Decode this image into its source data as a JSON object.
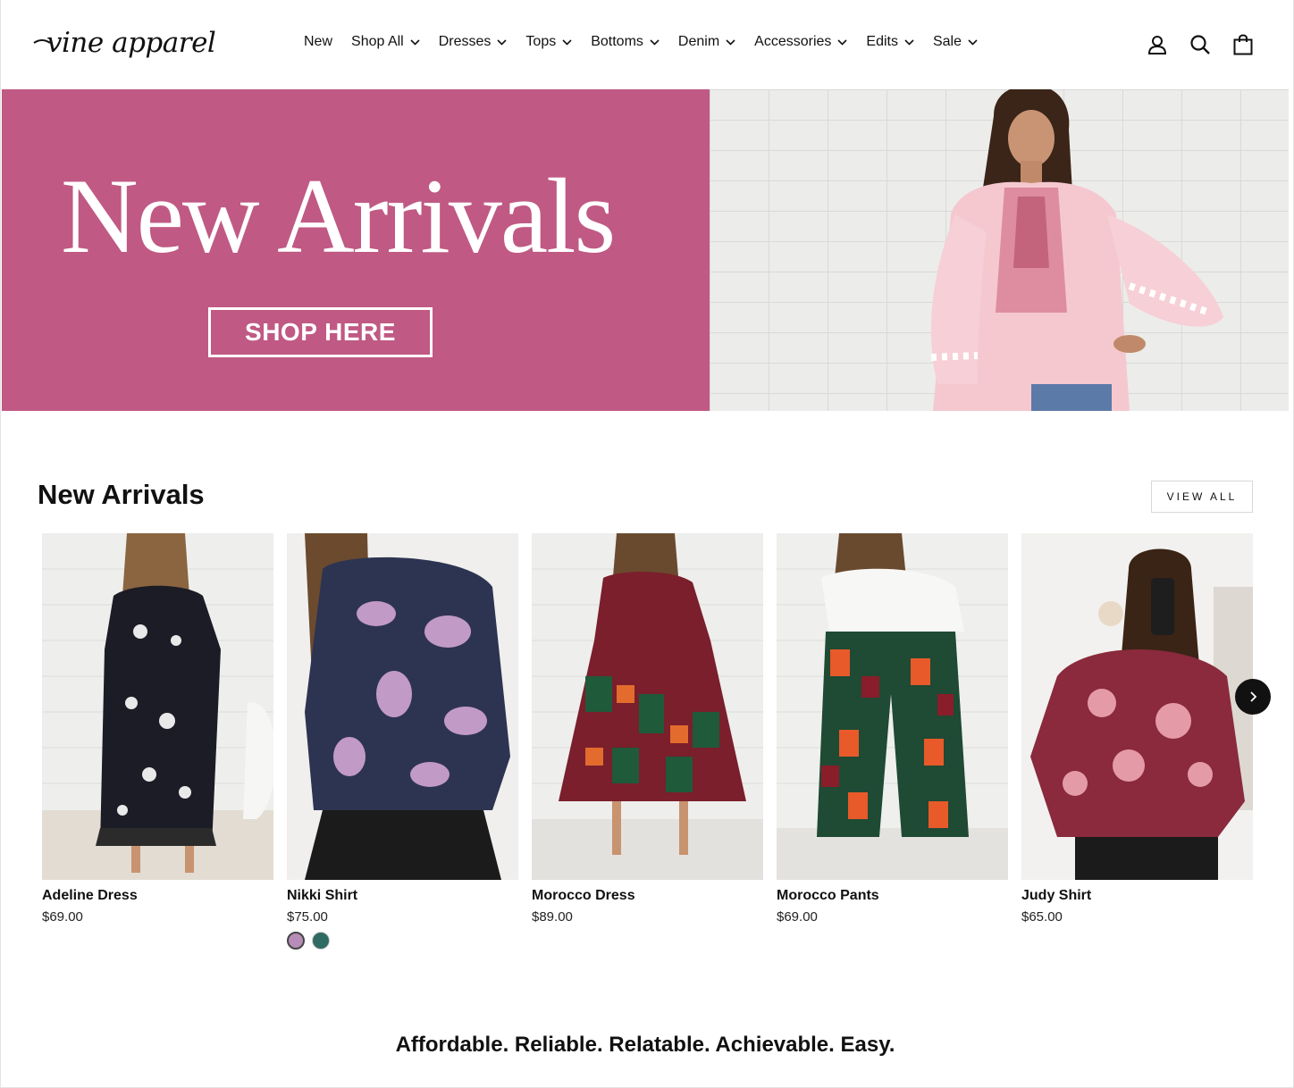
{
  "brand": {
    "name": "vine apparel"
  },
  "nav": {
    "items": [
      {
        "label": "New",
        "dropdown": false
      },
      {
        "label": "Shop All",
        "dropdown": true
      },
      {
        "label": "Dresses",
        "dropdown": true
      },
      {
        "label": "Tops",
        "dropdown": true
      },
      {
        "label": "Bottoms",
        "dropdown": true
      },
      {
        "label": "Denim",
        "dropdown": true
      },
      {
        "label": "Accessories",
        "dropdown": true
      },
      {
        "label": "Edits",
        "dropdown": true
      },
      {
        "label": "Sale",
        "dropdown": true
      }
    ]
  },
  "header_icons": [
    "account-icon",
    "search-icon",
    "cart-icon"
  ],
  "hero": {
    "title": "New Arrivals",
    "button_label": "SHOP HERE",
    "background_color": "#c05984"
  },
  "section": {
    "title": "New Arrivals",
    "view_all_label": "VIEW ALL"
  },
  "products": [
    {
      "name": "Adeline Dress",
      "price": "$69.00",
      "swatches": []
    },
    {
      "name": "Nikki Shirt",
      "price": "$75.00",
      "swatches": [
        "#b78cb8",
        "#2f6b63"
      ]
    },
    {
      "name": "Morocco Dress",
      "price": "$89.00",
      "swatches": []
    },
    {
      "name": "Morocco Pants",
      "price": "$69.00",
      "swatches": []
    },
    {
      "name": "Judy Shirt",
      "price": "$65.00",
      "swatches": []
    }
  ],
  "carousel": {
    "next_icon": "chevron-right-icon"
  },
  "tagline": "Affordable. Reliable. Relatable. Achievable. Easy."
}
